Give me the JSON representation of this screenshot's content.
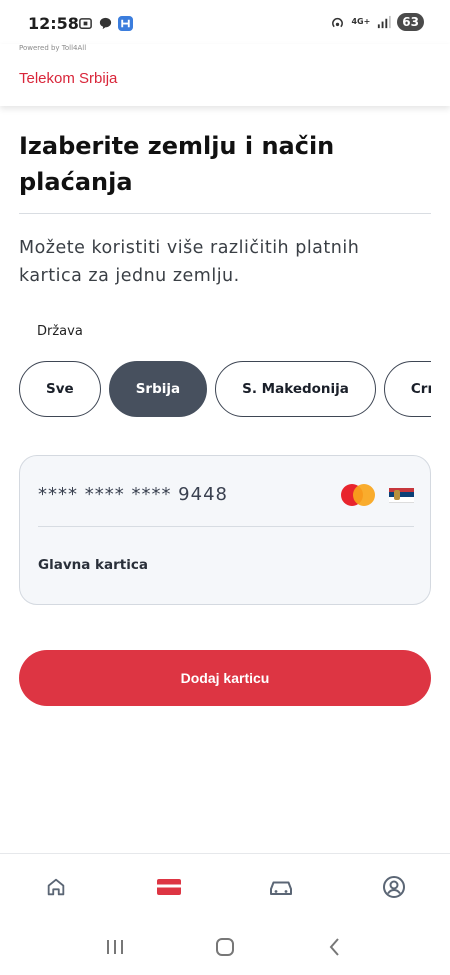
{
  "status": {
    "time": "12:58",
    "network": "4G+",
    "battery": "63",
    "left_icons": [
      "screenshot-icon",
      "chat-icon",
      "app-h-icon"
    ],
    "right_icons": [
      "hotspot-icon",
      "mobile-data-icon",
      "signal-icon"
    ]
  },
  "header": {
    "powered_by": "Powered by Toll4All",
    "brand": "Telekom Srbija"
  },
  "page": {
    "title": "Izaberite zemlju i način plaćanja",
    "subtitle": "Možete koristiti više različitih platnih kartica za jednu zemlju."
  },
  "country": {
    "label": "Država",
    "chips": [
      {
        "label": "Sve",
        "active": false
      },
      {
        "label": "Srbija",
        "active": true
      },
      {
        "label": "S. Makedonija",
        "active": false
      },
      {
        "label": "Crna Gora",
        "active": false
      }
    ]
  },
  "card": {
    "number": "**** **** **** 9448",
    "label": "Glavna kartica",
    "brand_icon": "mastercard-icon",
    "country_icon": "serbia-flag-icon"
  },
  "actions": {
    "add_card": "Dodaj karticu"
  },
  "bottom_nav": [
    {
      "icon": "home-icon",
      "active": false
    },
    {
      "icon": "card-icon",
      "active": true
    },
    {
      "icon": "car-icon",
      "active": false
    },
    {
      "icon": "profile-icon",
      "active": false
    }
  ],
  "colors": {
    "accent": "#dd3543",
    "brand_text": "#d9263a",
    "chip_active": "#47505e",
    "nav_inactive": "#5b6675"
  }
}
